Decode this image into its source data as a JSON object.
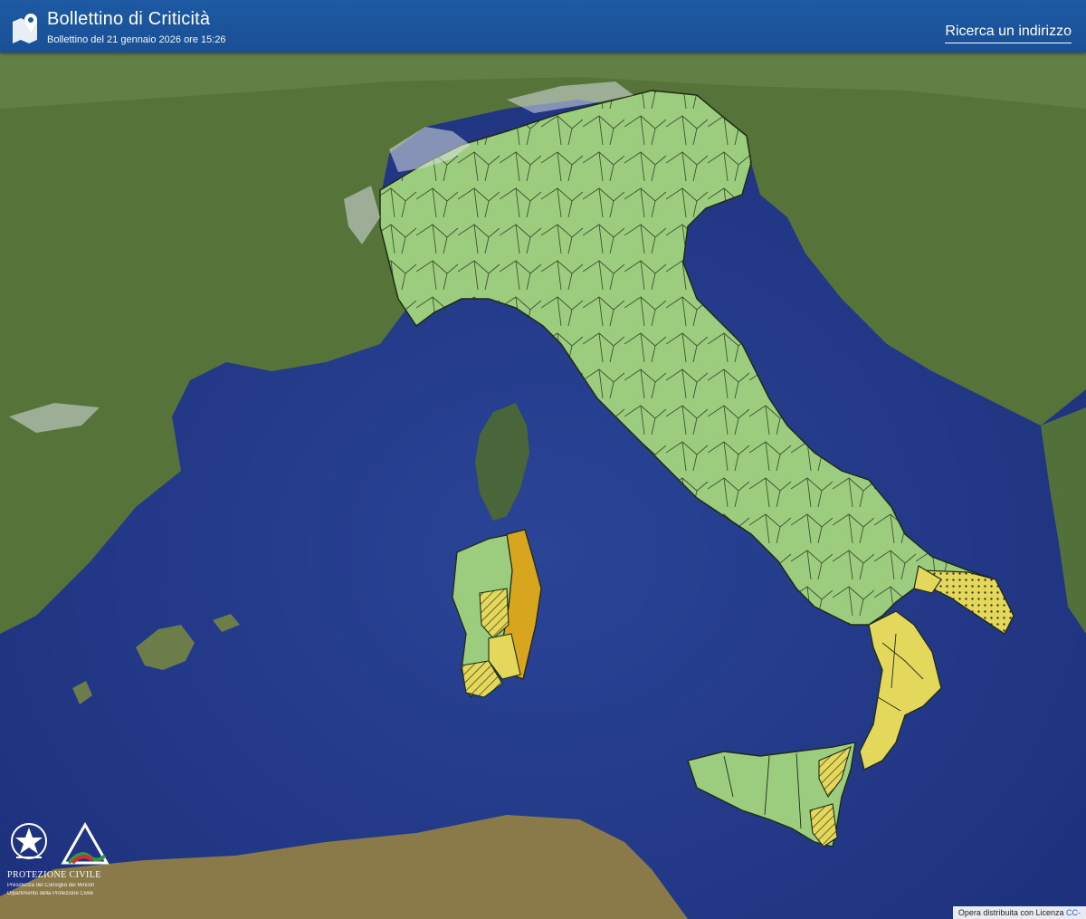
{
  "header": {
    "title": "Bollettino di Criticità",
    "subtitle": "Bollettino del 21 gennaio 2026 ore 15:26",
    "search_label": "Ricerca un indirizzo",
    "icon": "map-pin-icon"
  },
  "logo": {
    "org_name": "PROTEZIONE CIVILE",
    "org_sub1": "Presidenza del Consiglio dei Ministri",
    "org_sub2": "Dipartimento della Protezione Civile"
  },
  "attribution": {
    "text": "Opera distribuita con Licenza",
    "license": "CC-"
  },
  "colors": {
    "header_bg": "#1d5aa3",
    "sea": "#24388a",
    "land": "#5d7a3c",
    "alert_green": "#9ccc7e",
    "alert_yellow": "#e4d85c",
    "alert_orange": "#d8a61e",
    "border": "#1f2b16"
  }
}
